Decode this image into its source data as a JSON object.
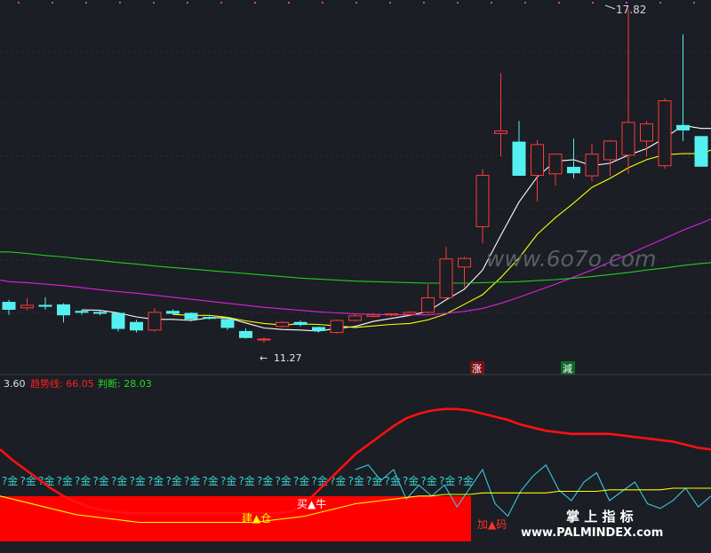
{
  "chart_data": [
    {
      "type": "candlestick",
      "panel": "price",
      "price_range": [
        10.6,
        18.0
      ],
      "annotations": {
        "high_label": "17.82",
        "low_label": "11.27",
        "rise_marker": "涨",
        "reduce_marker": "減",
        "watermark": "www.6o7o.com"
      },
      "candles": [
        {
          "o": 12.0,
          "h": 12.05,
          "l": 11.75,
          "c": 11.86
        },
        {
          "o": 11.89,
          "h": 12.08,
          "l": 11.84,
          "c": 11.94
        },
        {
          "o": 11.94,
          "h": 12.1,
          "l": 11.85,
          "c": 11.92
        },
        {
          "o": 11.95,
          "h": 11.98,
          "l": 11.6,
          "c": 11.75
        },
        {
          "o": 11.82,
          "h": 11.85,
          "l": 11.75,
          "c": 11.8
        },
        {
          "o": 11.8,
          "h": 11.83,
          "l": 11.74,
          "c": 11.78
        },
        {
          "o": 11.78,
          "h": 11.8,
          "l": 11.42,
          "c": 11.48
        },
        {
          "o": 11.6,
          "h": 11.65,
          "l": 11.4,
          "c": 11.45
        },
        {
          "o": 11.45,
          "h": 11.88,
          "l": 11.42,
          "c": 11.8
        },
        {
          "o": 11.82,
          "h": 11.86,
          "l": 11.76,
          "c": 11.78
        },
        {
          "o": 11.78,
          "h": 11.8,
          "l": 11.62,
          "c": 11.67
        },
        {
          "o": 11.7,
          "h": 11.72,
          "l": 11.66,
          "c": 11.68
        },
        {
          "o": 11.66,
          "h": 11.68,
          "l": 11.45,
          "c": 11.5
        },
        {
          "o": 11.42,
          "h": 11.48,
          "l": 11.28,
          "c": 11.3
        },
        {
          "o": 11.27,
          "h": 11.3,
          "l": 11.2,
          "c": 11.27
        },
        {
          "o": 11.52,
          "h": 11.62,
          "l": 11.5,
          "c": 11.6
        },
        {
          "o": 11.6,
          "h": 11.64,
          "l": 11.52,
          "c": 11.56
        },
        {
          "o": 11.5,
          "h": 11.52,
          "l": 11.4,
          "c": 11.44
        },
        {
          "o": 11.4,
          "h": 11.66,
          "l": 11.38,
          "c": 11.64
        },
        {
          "o": 11.64,
          "h": 11.78,
          "l": 11.62,
          "c": 11.73
        },
        {
          "o": 11.72,
          "h": 11.78,
          "l": 11.7,
          "c": 11.75
        },
        {
          "o": 11.75,
          "h": 11.78,
          "l": 11.72,
          "c": 11.77
        },
        {
          "o": 11.76,
          "h": 11.82,
          "l": 11.74,
          "c": 11.8
        },
        {
          "o": 11.8,
          "h": 12.35,
          "l": 11.78,
          "c": 12.09
        },
        {
          "o": 12.09,
          "h": 13.1,
          "l": 12.07,
          "c": 12.86
        },
        {
          "o": 12.7,
          "h": 12.9,
          "l": 12.3,
          "c": 12.87
        },
        {
          "o": 13.5,
          "h": 14.64,
          "l": 13.17,
          "c": 14.52
        },
        {
          "o": 15.35,
          "h": 16.55,
          "l": 14.9,
          "c": 15.4
        },
        {
          "o": 15.18,
          "h": 15.6,
          "l": 14.8,
          "c": 14.52
        },
        {
          "o": 14.52,
          "h": 15.22,
          "l": 14.0,
          "c": 15.13
        },
        {
          "o": 14.55,
          "h": 14.95,
          "l": 14.32,
          "c": 14.94
        },
        {
          "o": 14.68,
          "h": 15.25,
          "l": 14.46,
          "c": 14.57
        },
        {
          "o": 14.51,
          "h": 15.15,
          "l": 14.4,
          "c": 14.94
        },
        {
          "o": 14.83,
          "h": 15.22,
          "l": 14.5,
          "c": 15.2
        },
        {
          "o": 14.92,
          "h": 17.82,
          "l": 14.55,
          "c": 15.57
        },
        {
          "o": 15.2,
          "h": 15.6,
          "l": 14.9,
          "c": 15.54
        },
        {
          "o": 14.71,
          "h": 16.05,
          "l": 14.65,
          "c": 16.0
        },
        {
          "o": 15.51,
          "h": 17.32,
          "l": 15.2,
          "c": 15.42
        },
        {
          "o": 15.29,
          "h": 15.3,
          "l": 14.7,
          "c": 14.7
        },
        {
          "o": 14.6,
          "h": 17.0,
          "l": 14.55,
          "c": 15.58
        }
      ],
      "moving_averages": [
        {
          "name": "MA5",
          "color": "#ffffff",
          "values": [
            null,
            null,
            null,
            null,
            11.85,
            11.84,
            11.79,
            11.71,
            11.66,
            11.66,
            11.64,
            11.69,
            11.69,
            11.59,
            11.49,
            11.46,
            11.45,
            11.43,
            11.48,
            11.52,
            11.62,
            11.68,
            11.74,
            11.82,
            12.05,
            12.26,
            12.64,
            13.33,
            13.99,
            14.49,
            14.8,
            14.83,
            14.71,
            14.76,
            14.92,
            15.05,
            15.26,
            15.51,
            15.45,
            15.45
          ]
        },
        {
          "name": "MA10",
          "color": "#ffff00",
          "values": [
            null,
            null,
            null,
            null,
            null,
            null,
            null,
            null,
            null,
            11.76,
            11.74,
            11.74,
            11.7,
            11.63,
            11.58,
            11.55,
            11.57,
            11.56,
            11.53,
            11.5,
            11.53,
            11.56,
            11.58,
            11.65,
            11.77,
            11.96,
            12.15,
            12.49,
            12.88,
            13.35,
            13.68,
            13.97,
            14.28,
            14.46,
            14.67,
            14.83,
            14.93,
            14.95,
            14.95,
            15.08
          ]
        },
        {
          "name": "MA20",
          "color": "#e020e0",
          "values": [
            12.41,
            12.39,
            12.36,
            12.33,
            12.29,
            12.25,
            12.21,
            12.18,
            12.14,
            12.1,
            12.06,
            12.02,
            11.98,
            11.94,
            11.9,
            11.87,
            11.84,
            11.81,
            11.79,
            11.77,
            11.76,
            11.75,
            11.75,
            11.75,
            11.78,
            11.82,
            11.88,
            11.98,
            12.1,
            12.23,
            12.36,
            12.5,
            12.64,
            12.8,
            12.95,
            13.11,
            13.27,
            13.43,
            13.57,
            13.72
          ]
        },
        {
          "name": "MA60",
          "color": "#22cc22",
          "values": [
            13.0,
            12.97,
            12.93,
            12.9,
            12.86,
            12.83,
            12.79,
            12.76,
            12.72,
            12.69,
            12.66,
            12.63,
            12.6,
            12.57,
            12.54,
            12.51,
            12.48,
            12.46,
            12.44,
            12.42,
            12.41,
            12.4,
            12.39,
            12.38,
            12.38,
            12.38,
            12.39,
            12.4,
            12.41,
            12.43,
            12.45,
            12.48,
            12.51,
            12.55,
            12.59,
            12.64,
            12.68,
            12.73,
            12.77,
            12.8
          ]
        }
      ]
    },
    {
      "type": "line",
      "panel": "indicator",
      "y_range": [
        0,
        100
      ],
      "header": {
        "value_text": "3.60",
        "trend_label": "趋势线: 66.05",
        "judge_label": "判断: 28.03"
      },
      "series": [
        {
          "name": "趋势线",
          "color": "#ff1010",
          "values": [
            65,
            58,
            52,
            46,
            40,
            35,
            31,
            28,
            26,
            25,
            24,
            24,
            24,
            24,
            24,
            24,
            24,
            24,
            24,
            24,
            24,
            24,
            24,
            25,
            30,
            38,
            46,
            54,
            62,
            68,
            74,
            80,
            85,
            88,
            90,
            91,
            91,
            90,
            88,
            86,
            84,
            81,
            79,
            77,
            76,
            75,
            75,
            75,
            75,
            74,
            73,
            72,
            71,
            70,
            68,
            66,
            65
          ]
        },
        {
          "name": "判断",
          "color": "#3bc7e0",
          "values": [
            null,
            null,
            null,
            null,
            null,
            null,
            null,
            null,
            null,
            null,
            null,
            null,
            null,
            null,
            null,
            null,
            null,
            null,
            null,
            null,
            null,
            null,
            null,
            null,
            null,
            null,
            null,
            null,
            52,
            55,
            45,
            52,
            33,
            42,
            35,
            42,
            28,
            40,
            52,
            30,
            22,
            38,
            48,
            55,
            39,
            32,
            44,
            50,
            32,
            38,
            44,
            30,
            27,
            32,
            40,
            28,
            35
          ]
        },
        {
          "name": "建仓线",
          "color": "#ffff00",
          "values": [
            35,
            33,
            31,
            29,
            27,
            25,
            23,
            22,
            21,
            20,
            19,
            18,
            18,
            18,
            18,
            18,
            18,
            18,
            18,
            18,
            18,
            19,
            20,
            21,
            22,
            24,
            26,
            28,
            30,
            31,
            32,
            33,
            34,
            35,
            35,
            36,
            36,
            36,
            37,
            37,
            37,
            37,
            37,
            37,
            38,
            38,
            38,
            38,
            39,
            39,
            39,
            39,
            39,
            40,
            40,
            40,
            40
          ]
        }
      ],
      "labels": {
        "buy": "买▲牛",
        "build": "建▲仓",
        "add": "加▲码",
        "brand": "掌 上 指 标",
        "watermark": "www.PALMINDEX.com",
        "signal_glyph": "?金"
      }
    }
  ]
}
